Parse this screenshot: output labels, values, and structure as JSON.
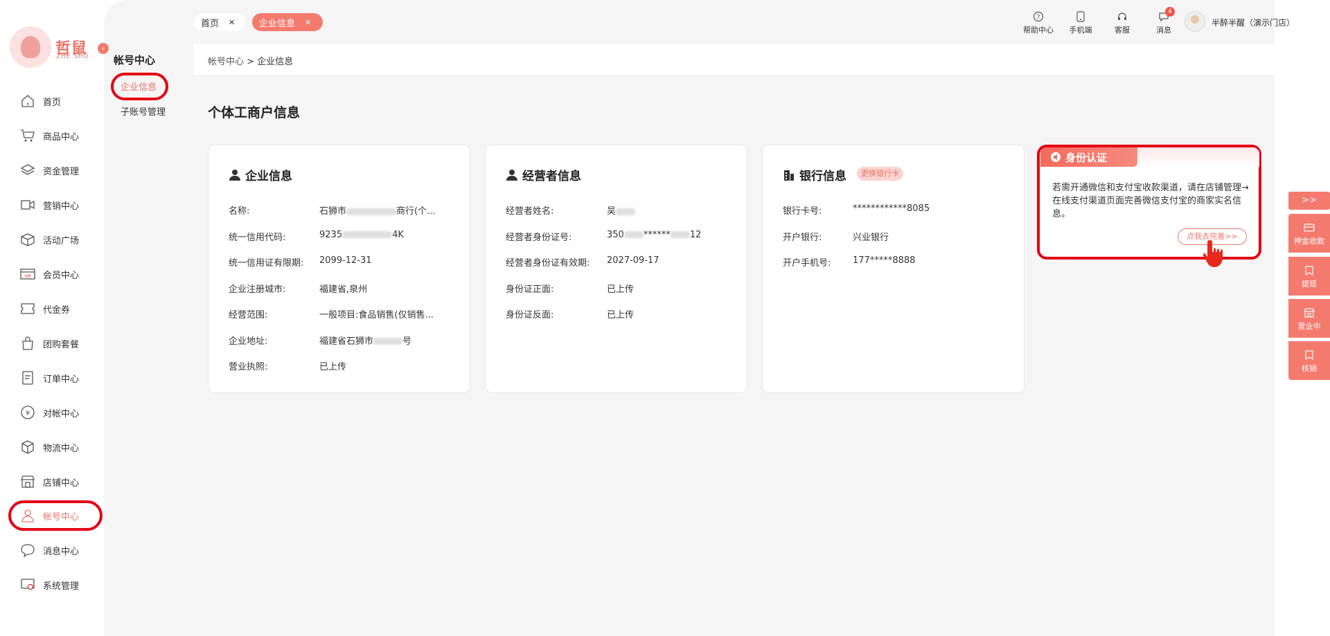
{
  "logo": {
    "text": "哲鼠",
    "sub": "ZHE SHU"
  },
  "nav": [
    {
      "label": "首页",
      "icon": "home-icon"
    },
    {
      "label": "商品中心",
      "icon": "cart-icon"
    },
    {
      "label": "资金管理",
      "icon": "layers-icon"
    },
    {
      "label": "营销中心",
      "icon": "promo-icon"
    },
    {
      "label": "活动广场",
      "icon": "box-icon"
    },
    {
      "label": "会员中心",
      "icon": "vip-icon"
    },
    {
      "label": "代金券",
      "icon": "coupon-icon"
    },
    {
      "label": "团购套餐",
      "icon": "bag-icon"
    },
    {
      "label": "订单中心",
      "icon": "order-icon"
    },
    {
      "label": "对帐中心",
      "icon": "yuan-icon"
    },
    {
      "label": "物流中心",
      "icon": "package-icon"
    },
    {
      "label": "店铺中心",
      "icon": "store-icon"
    },
    {
      "label": "帐号中心",
      "icon": "user-icon"
    },
    {
      "label": "消息中心",
      "icon": "message-icon"
    },
    {
      "label": "系统管理",
      "icon": "settings-icon"
    }
  ],
  "subnav": {
    "title": "帐号中心",
    "items": [
      "企业信息",
      "子账号管理"
    ]
  },
  "tabs": [
    {
      "label": "首页"
    },
    {
      "label": "企业信息"
    }
  ],
  "header": {
    "items": [
      "帮助中心",
      "手机端",
      "客服",
      "消息"
    ],
    "message_count": "4",
    "user": "半醉半醒（演示门店）"
  },
  "breadcrumb": {
    "root": "帐号中心",
    "current": "> 企业信息"
  },
  "page_title": "个体工商户信息",
  "company": {
    "title": "企业信息",
    "rows": [
      {
        "k": "名称:",
        "v1": "石狮市",
        "v2": "商行(个..."
      },
      {
        "k": "统一信用代码:",
        "v1": "9235",
        "v2": "4K"
      },
      {
        "k": "统一信用证有限期:",
        "v1": "2099-12-31",
        "v2": ""
      },
      {
        "k": "企业注册城市:",
        "v1": "福建省,泉州",
        "v2": ""
      },
      {
        "k": "经营范围:",
        "v1": "一般项目:食品销售(仅销售...",
        "v2": ""
      },
      {
        "k": "企业地址:",
        "v1": "福建省石狮市",
        "v2": "号"
      },
      {
        "k": "营业执照:",
        "v1": "已上传",
        "v2": ""
      }
    ]
  },
  "operator": {
    "title": "经营者信息",
    "rows": [
      {
        "k": "经营者姓名:",
        "v1": "吴",
        "v2": ""
      },
      {
        "k": "经营者身份证号:",
        "v1": "350",
        "v2": "******",
        "v3": "12"
      },
      {
        "k": "经营者身份证有效期:",
        "v1": "2027-09-17",
        "v2": ""
      },
      {
        "k": "身份证正面:",
        "v1": "已上传",
        "v2": ""
      },
      {
        "k": "身份证反面:",
        "v1": "已上传",
        "v2": ""
      }
    ]
  },
  "bank": {
    "title": "银行信息",
    "chip": "更换银行卡",
    "rows": [
      {
        "k": "银行卡号:",
        "v": "************8085"
      },
      {
        "k": "开户银行:",
        "v": "兴业银行"
      },
      {
        "k": "开户手机号:",
        "v": "177*****8888"
      }
    ]
  },
  "identity": {
    "title": "身份认证",
    "text": "若需开通微信和支付宝收款渠道，请在店铺管理→在线支付渠道页面完善微信支付宝的商家实名信息。",
    "button": "点我去完善>>"
  },
  "tools": [
    {
      "label": ">>",
      "icon": ""
    },
    {
      "label": "押金收款",
      "icon": "card-icon"
    },
    {
      "label": "提现",
      "icon": "withdraw-icon"
    },
    {
      "label": "营业中",
      "icon": "shop-icon"
    },
    {
      "label": "核销",
      "icon": "verify-icon"
    }
  ],
  "colors": {
    "accent": "#f47a6e",
    "highlight": "#e40014"
  }
}
